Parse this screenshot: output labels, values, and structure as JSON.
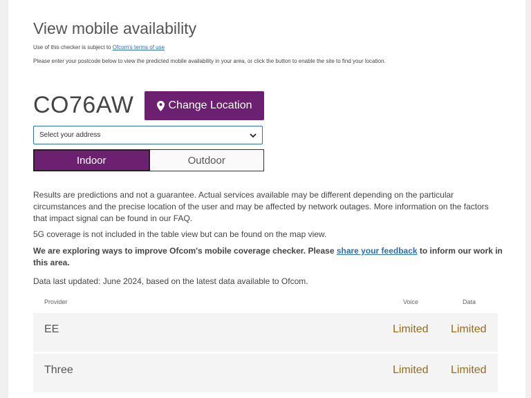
{
  "header": {
    "title": "View mobile availability",
    "terms_prefix": "Use of this checker is subject to ",
    "terms_link": "Ofcom's terms of use",
    "intro": "Please enter your postcode below to view the predicted mobile availability in your area, or click the button to enable the site to find your location."
  },
  "location": {
    "postcode": "CO76AW",
    "change_label": "Change Location",
    "address_select": "Select your address"
  },
  "toggle": {
    "indoor": "Indoor",
    "outdoor": "Outdoor",
    "selected": "Indoor"
  },
  "info": {
    "disclaimer": "Results are predictions and not a guarantee. Actual services available may be different depending on the particular circumstances and the precise location of the user and may be affected by network outages. More information on the factors that impact signal can be found in our FAQ.",
    "five_g_note": "5G coverage is not included in the table view but can be found on the map view.",
    "feedback_prefix": "We are exploring ways to improve Ofcom's mobile coverage checker. Please ",
    "feedback_link": "share your feedback",
    "feedback_suffix": " to inform our work in this area.",
    "updated": "Data last updated: June 2024, based on the latest data available to Ofcom."
  },
  "table": {
    "headers": {
      "provider": "Provider",
      "voice": "Voice",
      "data": "Data"
    },
    "rows": [
      {
        "provider": "EE",
        "voice": "Limited",
        "data": "Limited"
      },
      {
        "provider": "Three",
        "voice": "Limited",
        "data": "Limited"
      }
    ]
  },
  "colors": {
    "brand_purple": "#6c2170",
    "link_blue": "#2a6ebb",
    "limited_amber": "#9b6a1a"
  },
  "icons": {
    "location": "map-pin-icon",
    "dropdown": "chevron-down-icon"
  }
}
